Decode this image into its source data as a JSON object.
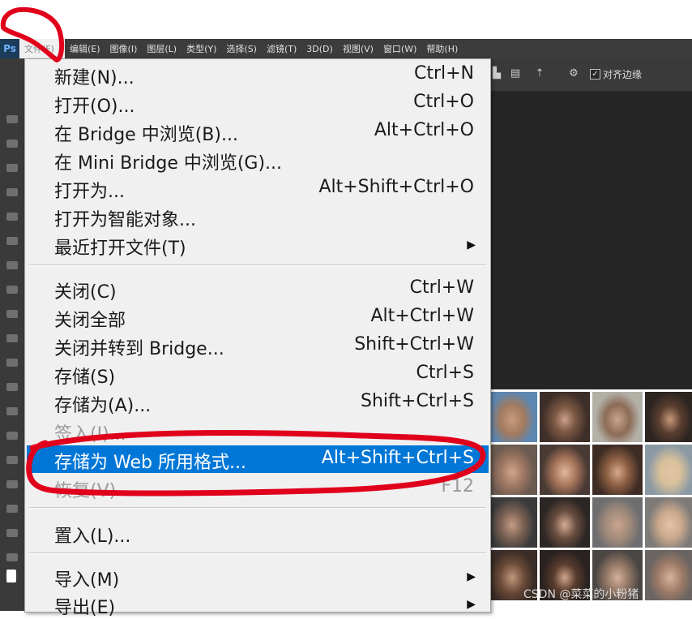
{
  "menubar": {
    "logo": "Ps",
    "items": [
      "文件(F)",
      "编辑(E)",
      "图像(I)",
      "图层(L)",
      "类型(Y)",
      "选择(S)",
      "滤镜(T)",
      "3D(D)",
      "视图(V)",
      "窗口(W)",
      "帮助(H)"
    ]
  },
  "optionsbar": {
    "align_edges_label": "对齐边缘",
    "align_edges_checked": true
  },
  "file_menu": {
    "group1": [
      {
        "label": "新建(N)...",
        "shortcut": "Ctrl+N"
      },
      {
        "label": "打开(O)...",
        "shortcut": "Ctrl+O"
      },
      {
        "label": "在 Bridge 中浏览(B)...",
        "shortcut": "Alt+Ctrl+O"
      },
      {
        "label": "在 Mini Bridge 中浏览(G)...",
        "shortcut": ""
      },
      {
        "label": "打开为...",
        "shortcut": "Alt+Shift+Ctrl+O"
      },
      {
        "label": "打开为智能对象...",
        "shortcut": ""
      },
      {
        "label": "最近打开文件(T)",
        "shortcut": "",
        "submenu": true
      }
    ],
    "group2": [
      {
        "label": "关闭(C)",
        "shortcut": "Ctrl+W"
      },
      {
        "label": "关闭全部",
        "shortcut": "Alt+Ctrl+W"
      },
      {
        "label": "关闭并转到 Bridge...",
        "shortcut": "Shift+Ctrl+W"
      },
      {
        "label": "存储(S)",
        "shortcut": "Ctrl+S"
      },
      {
        "label": "存储为(A)...",
        "shortcut": "Shift+Ctrl+S"
      },
      {
        "label": "签入(I)...",
        "shortcut": "",
        "disabled": true
      },
      {
        "label": "存储为 Web 所用格式...",
        "shortcut": "Alt+Shift+Ctrl+S",
        "highlighted": true
      },
      {
        "label": "恢复(V)",
        "shortcut": "F12",
        "disabled": true
      }
    ],
    "group3": [
      {
        "label": "置入(L)...",
        "shortcut": ""
      }
    ],
    "group4": [
      {
        "label": "导入(M)",
        "shortcut": "",
        "submenu": true
      },
      {
        "label": "导出(E)",
        "shortcut": "",
        "submenu": true
      }
    ]
  },
  "watermark": "CSDN @菜菜的小粉猪",
  "colors": {
    "highlight": "#0077d7",
    "annotation": "#e0001b",
    "menu_bg": "#f0f0f0",
    "app_bg": "#262626"
  }
}
